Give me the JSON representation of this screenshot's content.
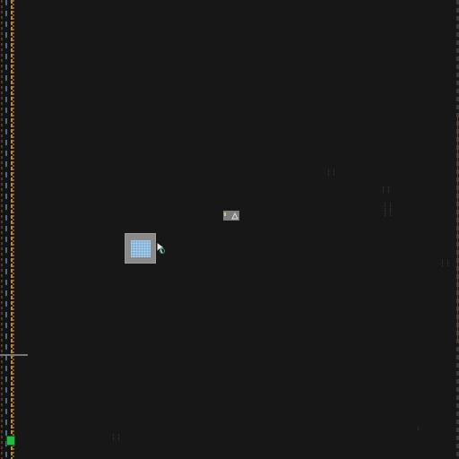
{
  "canvas": {
    "background": "#171717",
    "left_strip_colors": [
      "#5a3a20",
      "#4a6b8a",
      "#b78a48",
      "#8a5a2a"
    ],
    "status_marker_color": "#22bb44"
  },
  "objects": {
    "main": {
      "icon": "textured-block-icon",
      "fill": "#8a8a8a",
      "tile_color": "#7fb0d8"
    },
    "small": {
      "icon": "small-block-icon",
      "fill": "#7c7c7c"
    },
    "cursor": {
      "icon": "pointer-cursor-icon"
    }
  },
  "markers": [
    {
      "id": "m1",
      "icon": "dot-marker-icon"
    },
    {
      "id": "m2",
      "icon": "dot-marker-icon"
    },
    {
      "id": "m3",
      "icon": "dot-marker-icon"
    },
    {
      "id": "m4",
      "icon": "dot-marker-icon"
    },
    {
      "id": "m5",
      "icon": "dot-marker-icon"
    },
    {
      "id": "m6",
      "icon": "dot-marker-icon"
    }
  ]
}
